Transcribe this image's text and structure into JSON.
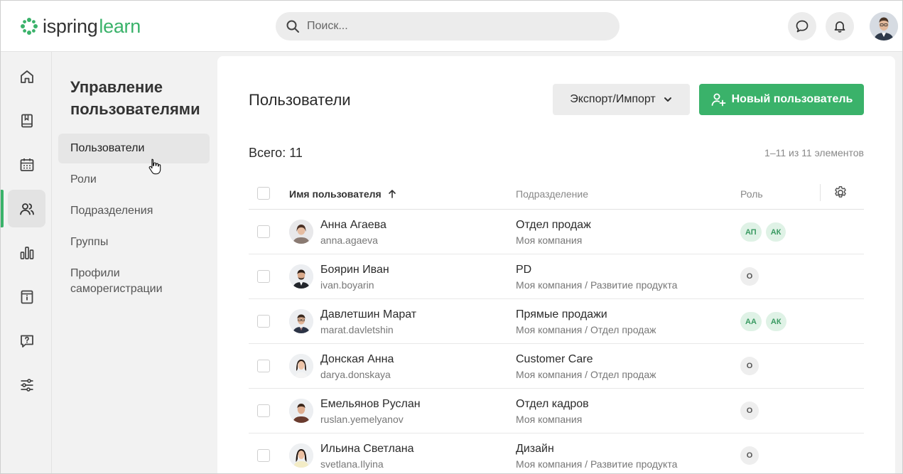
{
  "header": {
    "logo_word1": "ispring",
    "logo_word2": "learn",
    "search_placeholder": "Поиск...",
    "brand_color": "#3ab26a"
  },
  "rail": {
    "items": [
      {
        "icon": "home-icon"
      },
      {
        "icon": "book-icon"
      },
      {
        "icon": "calendar-icon"
      },
      {
        "icon": "users-icon",
        "active": true
      },
      {
        "icon": "chart-icon"
      },
      {
        "icon": "info-card-icon"
      },
      {
        "icon": "question-icon"
      },
      {
        "icon": "sliders-icon"
      }
    ]
  },
  "subnav": {
    "title": "Управление пользователями",
    "items": [
      {
        "label": "Пользователи",
        "active": true
      },
      {
        "label": "Роли"
      },
      {
        "label": "Подразделения"
      },
      {
        "label": "Группы"
      },
      {
        "label": "Профили саморегистрации"
      }
    ]
  },
  "main": {
    "title": "Пользователи",
    "export_label": "Экспорт/Импорт",
    "new_user_label": "Новый пользователь",
    "total_label": "Всего: 11",
    "pager_label": "1–11 из 11 элементов",
    "columns": {
      "name": "Имя пользователя",
      "dept": "Подразделение",
      "role": "Роль"
    },
    "rows": [
      {
        "name": "Анна Агаева",
        "login": "anna.agaeva",
        "dept": "Отдел продаж",
        "path": "Моя компания",
        "roles": [
          {
            "t": "АП",
            "c": "green"
          },
          {
            "t": "АК",
            "c": "green"
          }
        ]
      },
      {
        "name": "Боярин Иван",
        "login": "ivan.boyarin",
        "dept": "PD",
        "path": "Моя компания / Развитие продукта",
        "roles": [
          {
            "t": "О",
            "c": "gray"
          }
        ]
      },
      {
        "name": "Давлетшин Марат",
        "login": "marat.davletshin",
        "dept": "Прямые продажи",
        "path": "Моя компания / Отдел продаж",
        "roles": [
          {
            "t": "АА",
            "c": "green"
          },
          {
            "t": "АК",
            "c": "green"
          }
        ]
      },
      {
        "name": "Донская Анна",
        "login": "darya.donskaya",
        "dept": "Customer Care",
        "path": "Моя компания / Отдел продаж",
        "roles": [
          {
            "t": "О",
            "c": "gray"
          }
        ]
      },
      {
        "name": "Емельянов Руслан",
        "login": "ruslan.yemelyanov",
        "dept": "Отдел кадров",
        "path": "Моя компания",
        "roles": [
          {
            "t": "О",
            "c": "gray"
          }
        ]
      },
      {
        "name": "Ильина Светлана",
        "login": "svetlana.Ilyina",
        "dept": "Дизайн",
        "path": "Моя компания / Развитие продукта",
        "roles": [
          {
            "t": "О",
            "c": "gray"
          }
        ]
      }
    ]
  }
}
